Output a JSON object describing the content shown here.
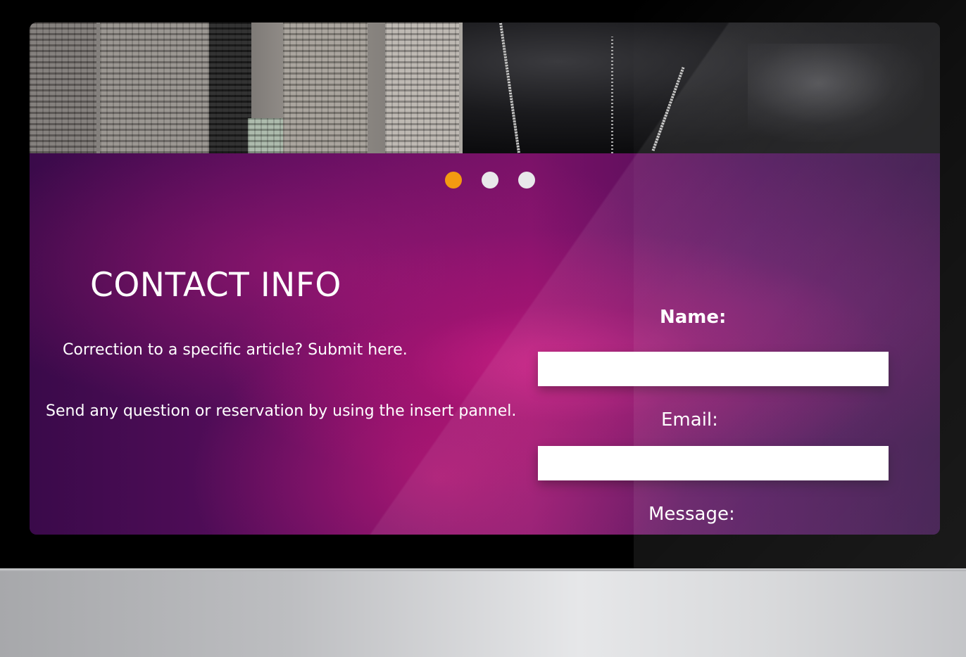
{
  "carousel": {
    "slide_count": 3,
    "active_index": 0,
    "active_color": "#f39a11",
    "inactive_color": "#e8e8ea"
  },
  "contact": {
    "title": "CONTACT INFO",
    "line1": "Correction to a specific article? Submit here.",
    "line2": "Send any question or reservation by using the insert pannel."
  },
  "form": {
    "name_label": "Name:",
    "name_value": "",
    "email_label": "Email:",
    "email_value": "",
    "message_label": "Message:"
  },
  "colors": {
    "panel_purple": "#5a0e5e",
    "panel_magenta": "#e0187a"
  }
}
